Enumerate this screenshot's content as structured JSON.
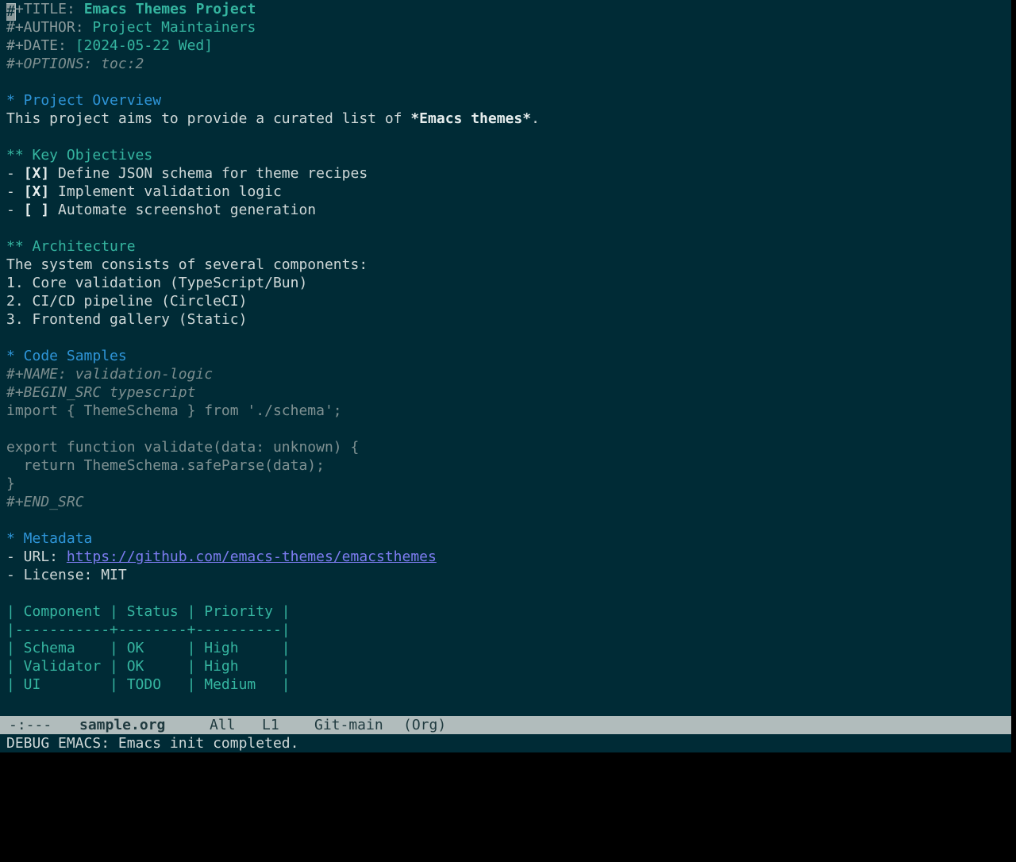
{
  "buffer": {
    "lines": {
      "title_kw": "#+TITLE: ",
      "title_cursor": "#",
      "title_kw_rest": "+TITLE: ",
      "title_value": "Emacs Themes Project",
      "author_kw": "#+AUTHOR: ",
      "author_value": "Project Maintainers",
      "date_kw": "#+DATE: ",
      "date_value": "[2024-05-22 Wed]",
      "options": "#+OPTIONS: toc:2",
      "h_overview": "* Project Overview",
      "overview_text_a": "This project aims to provide a curated list of ",
      "overview_bold": "*Emacs themes*",
      "overview_text_b": ".",
      "h_objectives": "** Key Objectives",
      "obj1_prefix": "- ",
      "obj1_box": "[X]",
      "obj1_text": " Define JSON schema for theme recipes",
      "obj2_prefix": "- ",
      "obj2_box": "[X]",
      "obj2_text": " Implement validation logic",
      "obj3_prefix": "- ",
      "obj3_box": "[ ]",
      "obj3_text": " Automate screenshot generation",
      "h_architecture": "** Architecture",
      "arch_intro": "The system consists of several components:",
      "arch_1": "1. Core validation (TypeScript/Bun)",
      "arch_2": "2. CI/CD pipeline (CircleCI)",
      "arch_3": "3. Frontend gallery (Static)",
      "h_code": "* Code Samples",
      "name_kw": "#+NAME: validation-logic",
      "begin_src": "#+BEGIN_SRC typescript",
      "code_1": "import { ThemeSchema } from './schema';",
      "code_2": "export function validate(data: unknown) {",
      "code_3": "  return ThemeSchema.safeParse(data);",
      "code_4": "}",
      "end_src": "#+END_SRC",
      "h_metadata": "* Metadata",
      "url_prefix": "- URL: ",
      "url": "https://github.com/emacs-themes/emacsthemes",
      "license": "- License: MIT",
      "table_header": "| Component | Status | Priority |",
      "table_rule": "|-----------+--------+----------|",
      "table_row1": "| Schema    | OK     | High     |",
      "table_row2": "| Validator | OK     | High     |",
      "table_row3": "| UI        | TODO   | Medium   |"
    }
  },
  "modeline": {
    "status": "-:---",
    "buffer_name": "sample.org",
    "position": "All",
    "line": "L1",
    "vc": "Git-main",
    "mode": "(Org)"
  },
  "echo_area": {
    "message": "DEBUG EMACS: Emacs init completed."
  },
  "colors": {
    "background": "#002b36",
    "heading1": "#2e95d8",
    "heading2": "#35b5a0",
    "link": "#7c7cf0",
    "modeline_bg": "#b1bcbc"
  }
}
